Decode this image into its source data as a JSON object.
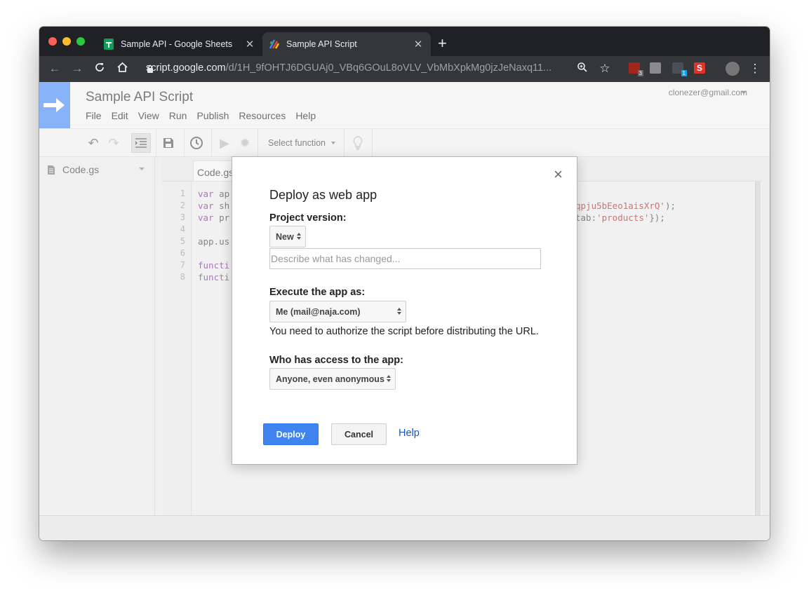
{
  "browser": {
    "tabs": [
      {
        "title": "Sample API - Google Sheets",
        "active": false
      },
      {
        "title": "Sample API Script",
        "active": true
      }
    ],
    "url_host": "script.google.com",
    "url_path": "/d/1H_9fOHTJ6DGUAj0_VBq6GOuL8oVLV_VbMbXpkMg0jzJeNaxq11...",
    "extension_badges": [
      "3",
      "1"
    ]
  },
  "app": {
    "title": "Sample API Script",
    "account": "clonezer@gmail.com",
    "menu": [
      "File",
      "Edit",
      "View",
      "Run",
      "Publish",
      "Resources",
      "Help"
    ],
    "toolbar": {
      "select_function": "Select function"
    }
  },
  "sidebar": {
    "file": "Code.gs"
  },
  "editor": {
    "tab": "Code.gs",
    "line_numbers": [
      "1",
      "2",
      "3",
      "4",
      "5",
      "6",
      "7",
      "8"
    ],
    "lines": [
      {
        "kw": "var",
        "rest": " ap"
      },
      {
        "kw": "var",
        "rest": " sh"
      },
      {
        "kw": "var",
        "rest": " pr"
      },
      {
        "kw": "",
        "rest": ""
      },
      {
        "kw": "",
        "rest": "app.us"
      },
      {
        "kw": "",
        "rest": ""
      },
      {
        "kw": "functi",
        "rest": ""
      },
      {
        "kw": "functi",
        "rest": ""
      }
    ],
    "line2_tail_str": "qpju5bEeo1aisXrQ'",
    "line2_tail_end": ");",
    "line3_tail_pre": "tab:",
    "line3_tail_str": "'products'",
    "line3_tail_end": "});"
  },
  "dialog": {
    "close": "×",
    "title": "Deploy as web app",
    "project_version_label": "Project version:",
    "project_version_value": "New",
    "change_placeholder": "Describe what has changed...",
    "execute_label": "Execute the app as:",
    "execute_value": "Me (mail@naja.com)",
    "auth_note": "You need to authorize the script before distributing the URL.",
    "access_label": "Who has access to the app:",
    "access_value": "Anyone, even anonymous",
    "deploy": "Deploy",
    "cancel": "Cancel",
    "help": "Help"
  }
}
